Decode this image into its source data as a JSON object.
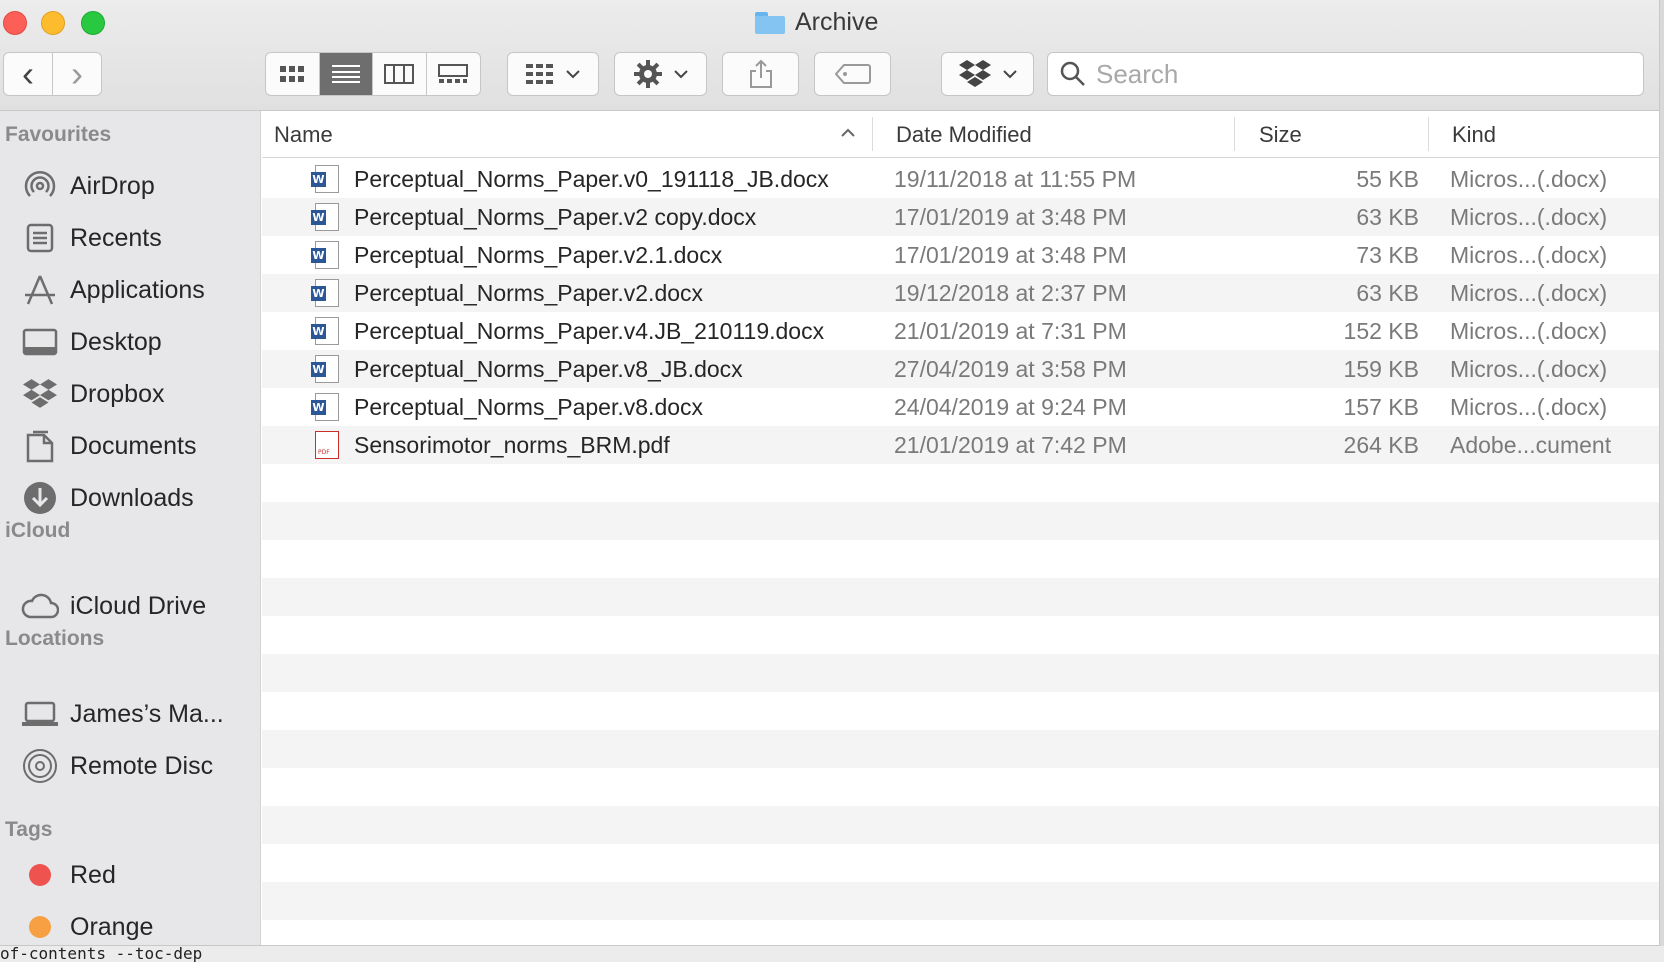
{
  "window": {
    "title": "Archive"
  },
  "toolbar": {
    "back_glyph": "‹",
    "forward_glyph": "›",
    "search_placeholder": "Search"
  },
  "sidebar": {
    "favourites_heading": "Favourites",
    "favourites": [
      {
        "label": "AirDrop",
        "icon": "airdrop-icon"
      },
      {
        "label": "Recents",
        "icon": "recents-icon"
      },
      {
        "label": "Applications",
        "icon": "applications-icon"
      },
      {
        "label": "Desktop",
        "icon": "desktop-icon"
      },
      {
        "label": "Dropbox",
        "icon": "dropbox-icon"
      },
      {
        "label": "Documents",
        "icon": "documents-icon"
      },
      {
        "label": "Downloads",
        "icon": "downloads-icon"
      }
    ],
    "icloud_heading": "iCloud",
    "icloud": [
      {
        "label": "iCloud Drive",
        "icon": "cloud-icon"
      }
    ],
    "locations_heading": "Locations",
    "locations": [
      {
        "label": "James’s Ma...",
        "icon": "laptop-icon"
      },
      {
        "label": "Remote Disc",
        "icon": "disc-icon"
      }
    ],
    "tags_heading": "Tags",
    "tags": [
      {
        "label": "Red",
        "color": "#ef5350"
      },
      {
        "label": "Orange",
        "color": "#f7a043"
      }
    ]
  },
  "columns": {
    "name": "Name",
    "date": "Date Modified",
    "size": "Size",
    "kind": "Kind"
  },
  "files": [
    {
      "name": "Perceptual_Norms_Paper.v0_191118_JB.docx",
      "date": "19/11/2018 at 11:55 PM",
      "size": "55 KB",
      "kind": "Micros...(.docx)",
      "type": "word"
    },
    {
      "name": "Perceptual_Norms_Paper.v2 copy.docx",
      "date": "17/01/2019 at 3:48 PM",
      "size": "63 KB",
      "kind": "Micros...(.docx)",
      "type": "word"
    },
    {
      "name": "Perceptual_Norms_Paper.v2.1.docx",
      "date": "17/01/2019 at 3:48 PM",
      "size": "73 KB",
      "kind": "Micros...(.docx)",
      "type": "word"
    },
    {
      "name": "Perceptual_Norms_Paper.v2.docx",
      "date": "19/12/2018 at 2:37 PM",
      "size": "63 KB",
      "kind": "Micros...(.docx)",
      "type": "word"
    },
    {
      "name": "Perceptual_Norms_Paper.v4.JB_210119.docx",
      "date": "21/01/2019 at 7:31 PM",
      "size": "152 KB",
      "kind": "Micros...(.docx)",
      "type": "word"
    },
    {
      "name": "Perceptual_Norms_Paper.v8_JB.docx",
      "date": "27/04/2019 at 3:58 PM",
      "size": "159 KB",
      "kind": "Micros...(.docx)",
      "type": "word"
    },
    {
      "name": "Perceptual_Norms_Paper.v8.docx",
      "date": "24/04/2019 at 9:24 PM",
      "size": "157 KB",
      "kind": "Micros...(.docx)",
      "type": "word"
    },
    {
      "name": "Sensorimotor_norms_BRM.pdf",
      "date": "21/01/2019 at 7:42 PM",
      "size": "264 KB",
      "kind": "Adobe...cument",
      "type": "pdf"
    }
  ],
  "terminal": {
    "text": "of-contents --toc-dep"
  }
}
